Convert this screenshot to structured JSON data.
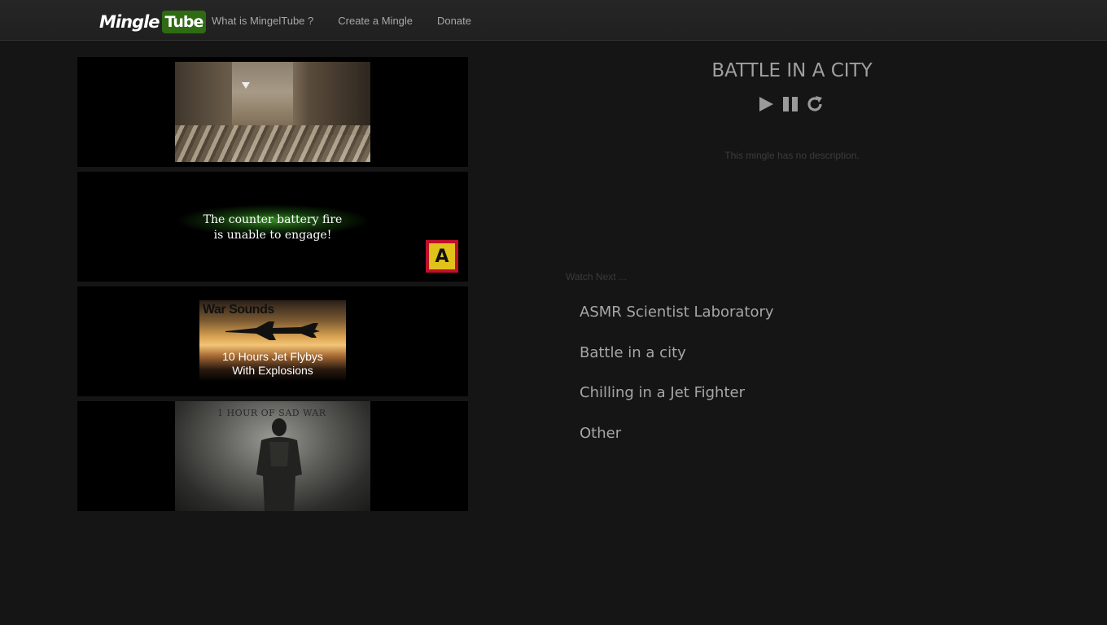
{
  "navbar": {
    "brand_part1": "Mingle",
    "brand_part2": "Tube",
    "links": [
      "What is MingelTube ?",
      "Create a Mingle",
      "Donate"
    ]
  },
  "videos": [
    {
      "icon": "ruined-city-thumbnail"
    },
    {
      "text_line1": "The counter battery fire",
      "text_line2": "is unable to engage!",
      "badge_letter": "A"
    },
    {
      "title": "War Sounds",
      "sub_line1": "10 Hours Jet Flybys",
      "sub_line2": "With Explosions"
    },
    {
      "title": "1 HOUR OF SAD WAR"
    }
  ],
  "mingle": {
    "title": "BATTLE IN A CITY",
    "description": "This mingle has no description.",
    "controls": [
      "play-icon",
      "pause-icon",
      "replay-icon"
    ]
  },
  "watch_next": {
    "label": "Watch Next ...",
    "items": [
      "ASMR Scientist Laboratory",
      "Battle in a city",
      "Chilling in a Jet Fighter",
      "Other"
    ]
  },
  "colors": {
    "background": "#151515",
    "navbar": "#232323",
    "brand_green": "#2e6b13",
    "text": "#a6a6a6"
  }
}
